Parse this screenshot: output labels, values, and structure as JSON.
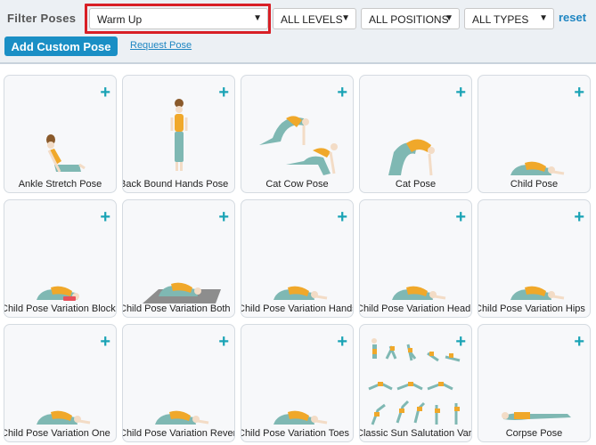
{
  "filters": {
    "label": "Filter Poses",
    "category": "Warm Up",
    "level": "ALL LEVELS",
    "position": "ALL POSITIONS",
    "type": "ALL TYPES",
    "reset": "reset"
  },
  "actions": {
    "add_custom": "Add Custom Pose",
    "request": "Request Pose"
  },
  "add_symbol": "+",
  "colors": {
    "accent": "#1a8fc5",
    "plus": "#1aa3b5",
    "top_orange": "#f0a82a",
    "leggings_teal": "#7fb8b3",
    "skin": "#f3dcc6",
    "hair": "#8a5a2b",
    "highlight": "#d81f26"
  },
  "poses": [
    {
      "name": "Ankle Stretch Pose",
      "figure": "seated-bend"
    },
    {
      "name": "Back Bound Hands Pose",
      "figure": "standing-back"
    },
    {
      "name": "Cat Cow Pose",
      "figure": "cat-cow"
    },
    {
      "name": "Cat Pose",
      "figure": "cat"
    },
    {
      "name": "Child Pose",
      "figure": "child"
    },
    {
      "name": "Child Pose Variation Block",
      "figure": "child-block"
    },
    {
      "name": "Child Pose Variation Both",
      "figure": "child-mat"
    },
    {
      "name": "Child Pose Variation Hands",
      "figure": "child"
    },
    {
      "name": "Child Pose Variation Head",
      "figure": "child"
    },
    {
      "name": "Child Pose Variation Hips",
      "figure": "child"
    },
    {
      "name": "Child Pose Variation One",
      "figure": "child"
    },
    {
      "name": "Child Pose Variation Reverse",
      "figure": "child"
    },
    {
      "name": "Child Pose Variation Toes",
      "figure": "child"
    },
    {
      "name": "Classic Sun Salutation Variation",
      "figure": "sun-salutation"
    },
    {
      "name": "Corpse Pose",
      "figure": "corpse"
    }
  ]
}
